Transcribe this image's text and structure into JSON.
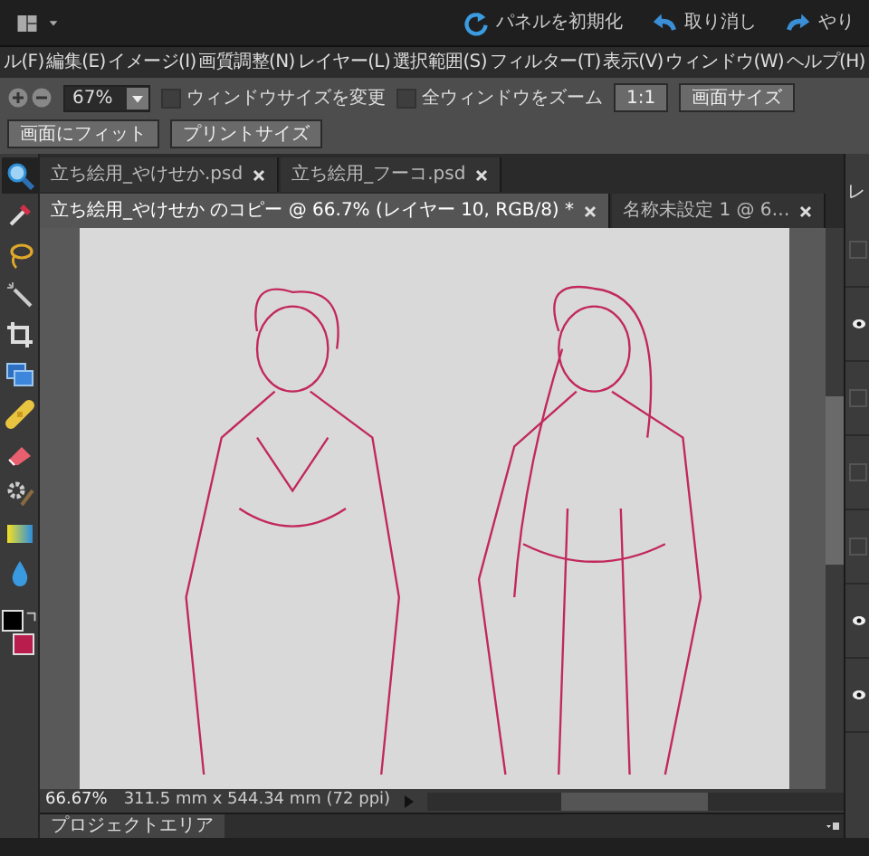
{
  "top_bar": {
    "actions": [
      {
        "kind": "reset",
        "label": "パネルを初期化"
      },
      {
        "kind": "undo",
        "label": "取り消し"
      },
      {
        "kind": "redo",
        "label": "やり"
      }
    ]
  },
  "menu_bar": [
    "ル(F)",
    "編集(E)",
    "イメージ(I)",
    "画質調整(N)",
    "レイヤー(L)",
    "選択範囲(S)",
    "フィルター(T)",
    "表示(V)",
    "ウィンドウ(W)",
    "ヘルプ(H)"
  ],
  "options_bar": {
    "zoom": "67%",
    "checkboxes": [
      {
        "label": "ウィンドウサイズを変更",
        "checked": false
      },
      {
        "label": "全ウィンドウをズーム",
        "checked": false
      }
    ],
    "buttons": [
      "1:1",
      "画面サイズ",
      "画面にフィット",
      "プリントサイズ"
    ]
  },
  "tabs": [
    {
      "label": "立ち絵用_やけせか.psd",
      "selected": false
    },
    {
      "label": "立ち絵用_フーコ.psd",
      "selected": false
    },
    {
      "label": "立ち絵用_やけせか のコピー @ 66.7% (レイヤー 10, RGB/8) *",
      "selected": true
    },
    {
      "label": "名称未設定 1 @ 6…",
      "selected": false
    }
  ],
  "toolbox": {
    "tools": [
      {
        "kind": "zoom",
        "selected": true
      },
      {
        "kind": "eyedropper",
        "selected": false
      },
      {
        "kind": "lasso",
        "selected": false
      },
      {
        "kind": "wand",
        "selected": false
      },
      {
        "kind": "crop",
        "selected": false
      },
      {
        "kind": "stack",
        "selected": false
      },
      {
        "kind": "bandage",
        "selected": false
      },
      {
        "kind": "eraser",
        "selected": false
      },
      {
        "kind": "gearbrush",
        "selected": false
      },
      {
        "kind": "gradient",
        "selected": false
      },
      {
        "kind": "drop",
        "selected": false
      }
    ],
    "swatches": [
      {
        "kind": "foreground",
        "color": "#000000"
      },
      {
        "kind": "background",
        "color": "#b81d4e"
      }
    ]
  },
  "status_bar": {
    "zoom": "66.67%",
    "document_size": "311.5 mm x 544.34 mm (72 ppi)"
  },
  "project_area": {
    "title": "プロジェクトエリア"
  },
  "layers_panel": {
    "title": "レ",
    "layers": [
      {
        "visible": false
      },
      {
        "visible": true
      },
      {
        "visible": false
      },
      {
        "visible": false
      },
      {
        "visible": false
      },
      {
        "visible": true
      },
      {
        "visible": true
      }
    ]
  }
}
